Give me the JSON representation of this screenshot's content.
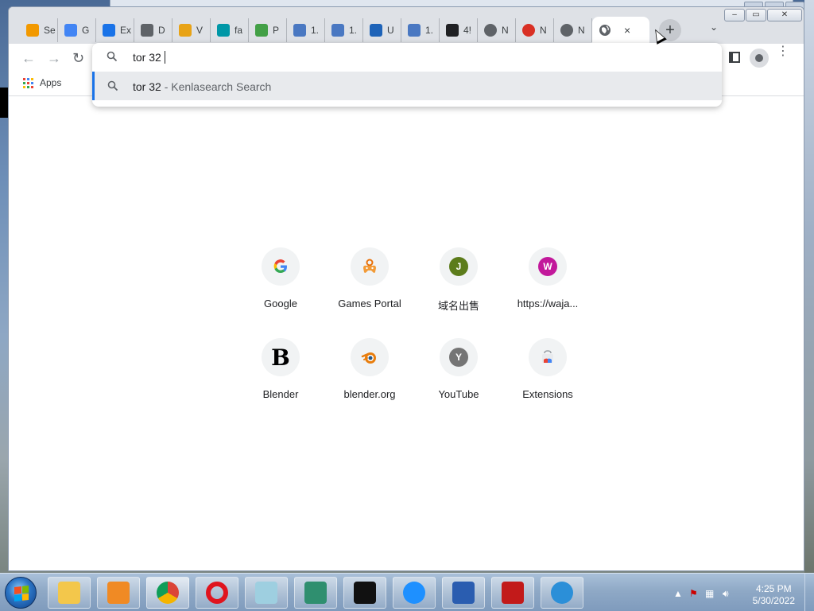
{
  "browser": {
    "tabs": [
      {
        "title": "Se",
        "icon": "person-orange-icon",
        "color": "#f29900"
      },
      {
        "title": "G",
        "icon": "google-icon",
        "color": "#4285f4"
      },
      {
        "title": "Ex",
        "icon": "puzzle-icon",
        "color": "#1a73e8"
      },
      {
        "title": "D",
        "icon": "speaker-icon",
        "color": "#5f6368"
      },
      {
        "title": "V",
        "icon": "bee-icon",
        "color": "#e8a317"
      },
      {
        "title": "fa",
        "icon": "teal-app-icon",
        "color": "#0097a7"
      },
      {
        "title": "P",
        "icon": "folder-icon",
        "color": "#43a047"
      },
      {
        "title": "1.",
        "icon": "page-blue-icon",
        "color": "#4a78c2"
      },
      {
        "title": "1.",
        "icon": "page-blue-icon",
        "color": "#4a78c2"
      },
      {
        "title": "U",
        "icon": "up-logo-icon",
        "color": "#1e63b8"
      },
      {
        "title": "1.",
        "icon": "page-blue-icon",
        "color": "#4a78c2"
      },
      {
        "title": "4!",
        "icon": "mountain-icon",
        "color": "#202124"
      },
      {
        "title": "N",
        "icon": "globe-icon",
        "color": "#5f6368"
      },
      {
        "title": "N",
        "icon": "red-emblem-icon",
        "color": "#d93025"
      },
      {
        "title": "N",
        "icon": "globe-icon",
        "color": "#5f6368"
      }
    ],
    "active_tab": {
      "title": "",
      "close": "×"
    },
    "new_tab_symbol": "+",
    "tab_search_symbol": "⌄",
    "nav": {
      "back": "←",
      "forward": "→",
      "reload": "↻"
    },
    "menu_symbol": "⋮",
    "bookmarks": {
      "apps_label": "Apps"
    },
    "omnibox": {
      "value": "tor 32",
      "suggestion": {
        "query": "tor 32",
        "separator": " - ",
        "engine": "Kenlasearch Search"
      }
    }
  },
  "shortcuts": [
    {
      "label": "Google",
      "icon": "google-g-icon",
      "letter": "G",
      "color": "#4285f4"
    },
    {
      "label": "Games Portal",
      "icon": "gamepad-icon",
      "letter": "",
      "color": "#e8710a"
    },
    {
      "label": "域名出售",
      "icon": "letter-avatar-icon",
      "letter": "J",
      "color": "#5c7c1b"
    },
    {
      "label": "https://waja...",
      "icon": "letter-avatar-icon",
      "letter": "W",
      "color": "#c2189b"
    },
    {
      "label": "Blender",
      "icon": "blender-b-icon",
      "letter": "B",
      "color": "#000000"
    },
    {
      "label": "blender.org",
      "icon": "blender-logo-icon",
      "letter": "",
      "color": "#e87d0d"
    },
    {
      "label": "YouTube",
      "icon": "letter-avatar-icon",
      "letter": "Y",
      "color": "#757575"
    },
    {
      "label": "Extensions",
      "icon": "chrome-store-icon",
      "letter": "",
      "color": "#ea4335"
    }
  ],
  "taskbar": {
    "items": [
      {
        "name": "explorer-taskbar",
        "icon": "folder-icon",
        "color": "#f3c74b"
      },
      {
        "name": "media-player-taskbar",
        "icon": "media-icon",
        "color": "#f08a24"
      },
      {
        "name": "chrome-taskbar",
        "icon": "chrome-icon",
        "color": "#db4437"
      },
      {
        "name": "opera-taskbar",
        "icon": "opera-icon",
        "color": "#e0141e"
      },
      {
        "name": "notepad-taskbar",
        "icon": "notepad-icon",
        "color": "#9ecfe0"
      },
      {
        "name": "cubes-taskbar",
        "icon": "cubes-icon",
        "color": "#2f8f6f"
      },
      {
        "name": "7zip-taskbar",
        "icon": "7z-icon",
        "color": "#111111"
      },
      {
        "name": "player-taskbar",
        "icon": "play-circle-icon",
        "color": "#1e90ff"
      },
      {
        "name": "monitor-taskbar",
        "icon": "monitor-icon",
        "color": "#2a5db0"
      },
      {
        "name": "red-app-taskbar",
        "icon": "red-app-icon",
        "color": "#c21a1a"
      },
      {
        "name": "ie-taskbar",
        "icon": "ie-icon",
        "color": "#2b8fd8"
      }
    ],
    "tray": {
      "time": "4:25 PM",
      "date": "5/30/2022"
    }
  }
}
